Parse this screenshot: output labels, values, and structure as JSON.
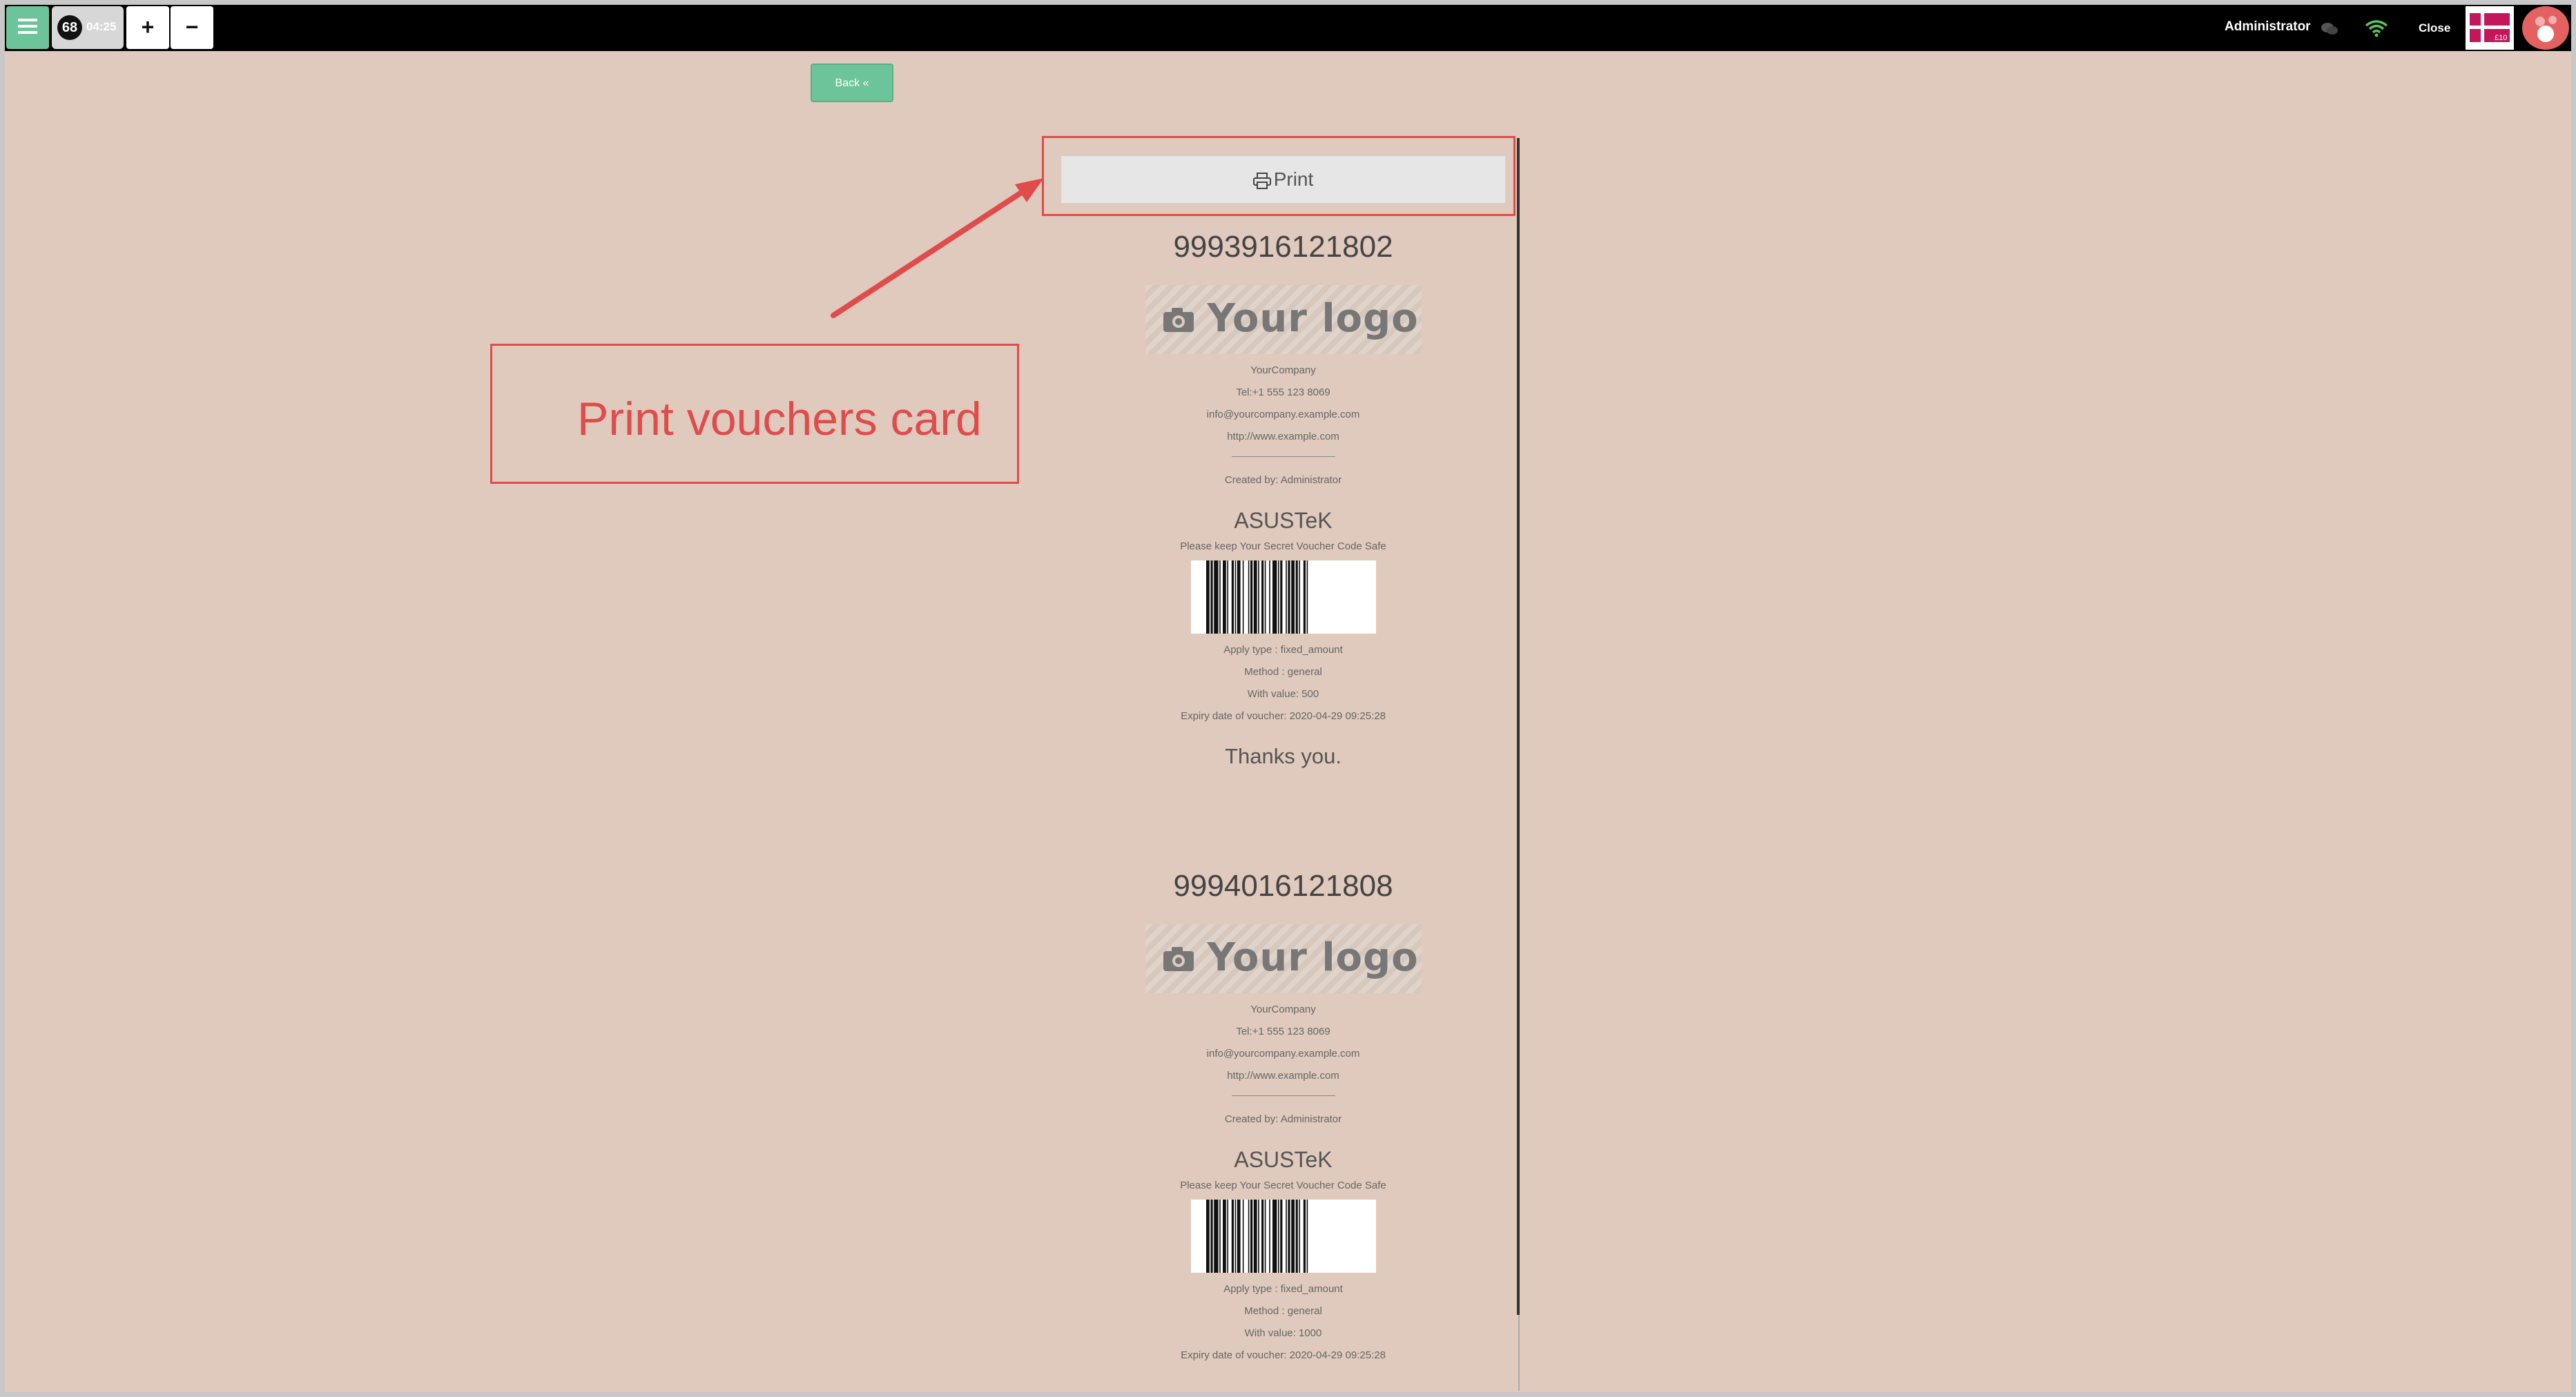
{
  "topbar": {
    "order_count": "68",
    "time": "04:25",
    "plus_label": "+",
    "minus_label": "−",
    "user_name": "Administrator",
    "close_label": "Close",
    "voucher_badge": "£10"
  },
  "back_button": {
    "label": "Back"
  },
  "print_button": {
    "label": "Print"
  },
  "annotation": {
    "text": "Print vouchers card"
  },
  "vouchers": [
    {
      "code": "9993916121802",
      "logo_text": "Your logo",
      "company": "YourCompany",
      "phone": "Tel:+1 555 123 8069",
      "email": "info@yourcompany.example.com",
      "website": "http://www.example.com",
      "created_by": "Created by: Administrator",
      "customer": "ASUSTeK",
      "notice": "Please keep Your Secret Voucher Code Safe",
      "apply_type": "Apply type : fixed_amount",
      "method": "Method : general",
      "value": "With value: 500",
      "expiry": "Expiry date of voucher: 2020-04-29 09:25:28",
      "thanks": "Thanks you."
    },
    {
      "code": "9994016121808",
      "logo_text": "Your logo",
      "company": "YourCompany",
      "phone": "Tel:+1 555 123 8069",
      "email": "info@yourcompany.example.com",
      "website": "http://www.example.com",
      "created_by": "Created by: Administrator",
      "customer": "ASUSTeK",
      "notice": "Please keep Your Secret Voucher Code Safe",
      "apply_type": "Apply type : fixed_amount",
      "method": "Method : general",
      "value": "With value: 1000",
      "expiry": "Expiry date of voucher: 2020-04-29 09:25:28"
    }
  ],
  "colors": {
    "accent": "#6ec49a",
    "annotation": "#e04b4b",
    "background": "#dfcabd"
  }
}
